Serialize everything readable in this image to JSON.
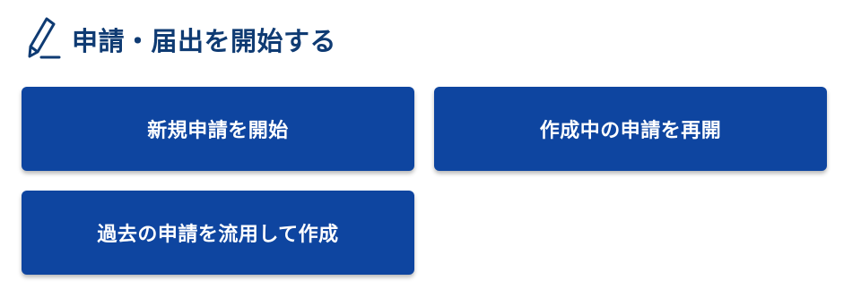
{
  "section": {
    "title": "申請・届出を開始する",
    "icon": "pen-icon"
  },
  "buttons": {
    "new_application": "新規申請を開始",
    "resume_draft": "作成中の申請を再開",
    "reuse_past": "過去の申請を流用して作成"
  },
  "colors": {
    "title": "#0f3b73",
    "button_bg": "#0e45a0",
    "button_text": "#ffffff"
  }
}
